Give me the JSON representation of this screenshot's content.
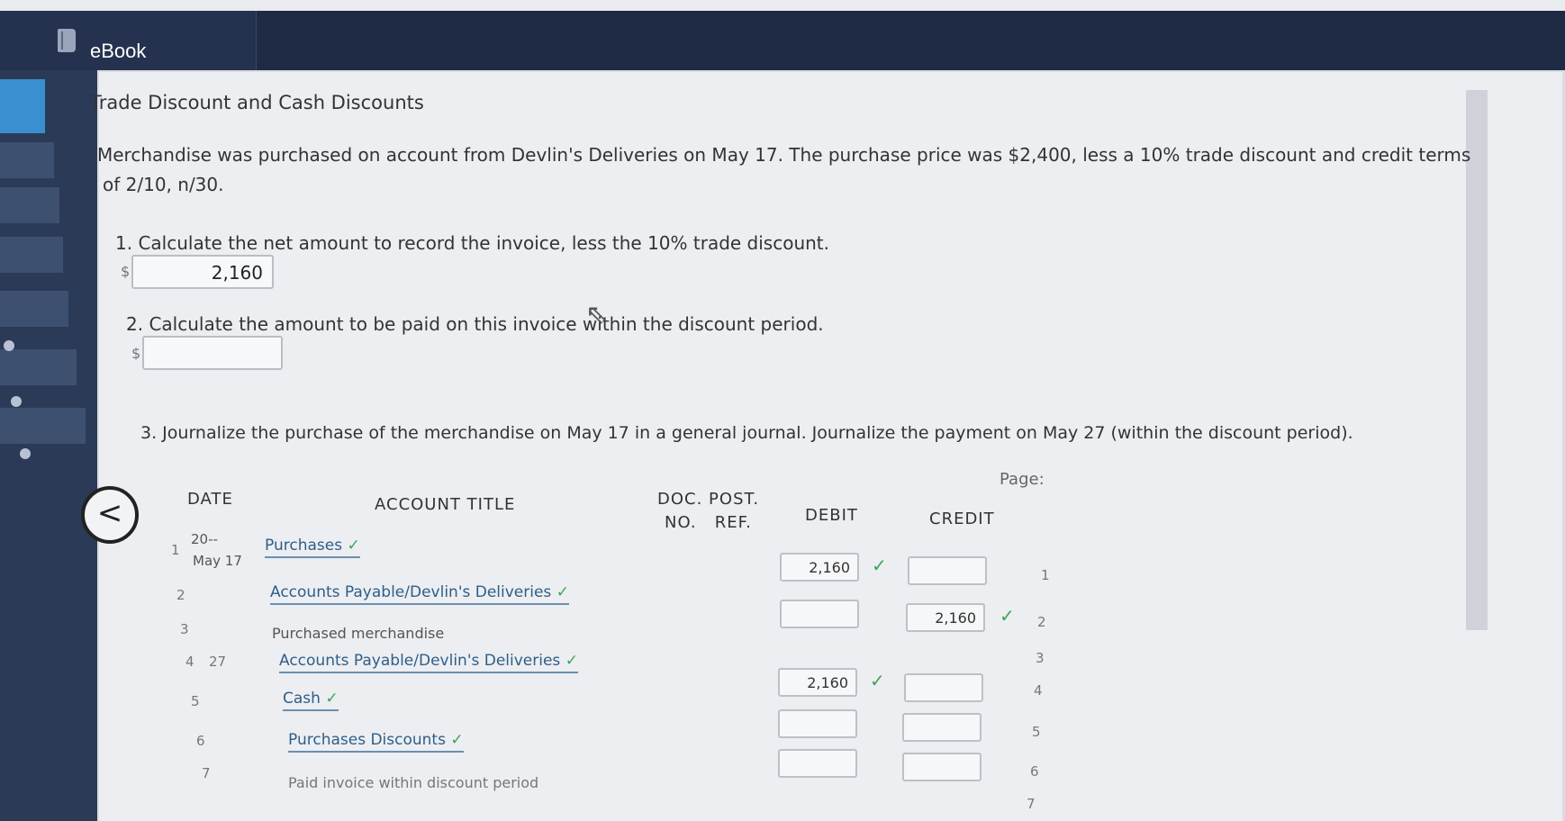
{
  "app": {
    "title": "eBook"
  },
  "page": {
    "heading": "Trade Discount and Cash Discounts"
  },
  "problem": {
    "text_line1": "Merchandise was purchased on account from Devlin's Deliveries on May 17. The purchase price was $2,400, less a 10% trade discount and credit terms",
    "text_line2": "of 2/10, n/30."
  },
  "q1": {
    "label": "1. Calculate the net amount to record the invoice, less the 10% trade discount.",
    "currency": "$",
    "value": "2,160"
  },
  "q2": {
    "label": "2. Calculate the amount to be paid on this invoice within the discount period.",
    "currency": "$",
    "value": ""
  },
  "q3": {
    "label": "3. Journalize the purchase of the merchandise on May 17 in a general journal. Journalize the payment on May 27 (within the discount period)."
  },
  "journal": {
    "page_label": "Page:",
    "headers": {
      "date": "DATE",
      "account_title": "ACCOUNT TITLE",
      "doc_post": "DOC. POST.",
      "no_ref": "NO.   REF.",
      "debit": "DEBIT",
      "credit": "CREDIT"
    },
    "date_year": "20--",
    "date_may17": "May 17",
    "rows": [
      {
        "num": "1",
        "date": "",
        "account": "Purchases",
        "debit": "2,160",
        "credit": "",
        "right_num": "1"
      },
      {
        "num": "2",
        "date": "",
        "account": "Accounts Payable/Devlin's Deliveries",
        "debit": "",
        "credit": "2,160",
        "right_num": "2"
      },
      {
        "num": "3",
        "date": "",
        "account": "Purchased merchandise",
        "debit": "",
        "credit": "",
        "right_num": "3"
      },
      {
        "num": "4",
        "date": "27",
        "account": "Accounts Payable/Devlin's Deliveries",
        "debit": "2,160",
        "credit": "",
        "right_num": "4"
      },
      {
        "num": "5",
        "date": "",
        "account": "Cash",
        "debit": "",
        "credit": "",
        "right_num": "5"
      },
      {
        "num": "6",
        "date": "",
        "account": "Purchases Discounts",
        "debit": "",
        "credit": "",
        "right_num": "6"
      },
      {
        "num": "7",
        "date": "",
        "account": "Paid invoice within discount period",
        "debit": "",
        "credit": "",
        "right_num": "7"
      }
    ]
  },
  "icons": {
    "check": "✓",
    "back": "<",
    "book": "book-icon"
  },
  "colors": {
    "header": "#1f2a44",
    "check": "#3aa55a",
    "link": "#2d5e8a"
  }
}
